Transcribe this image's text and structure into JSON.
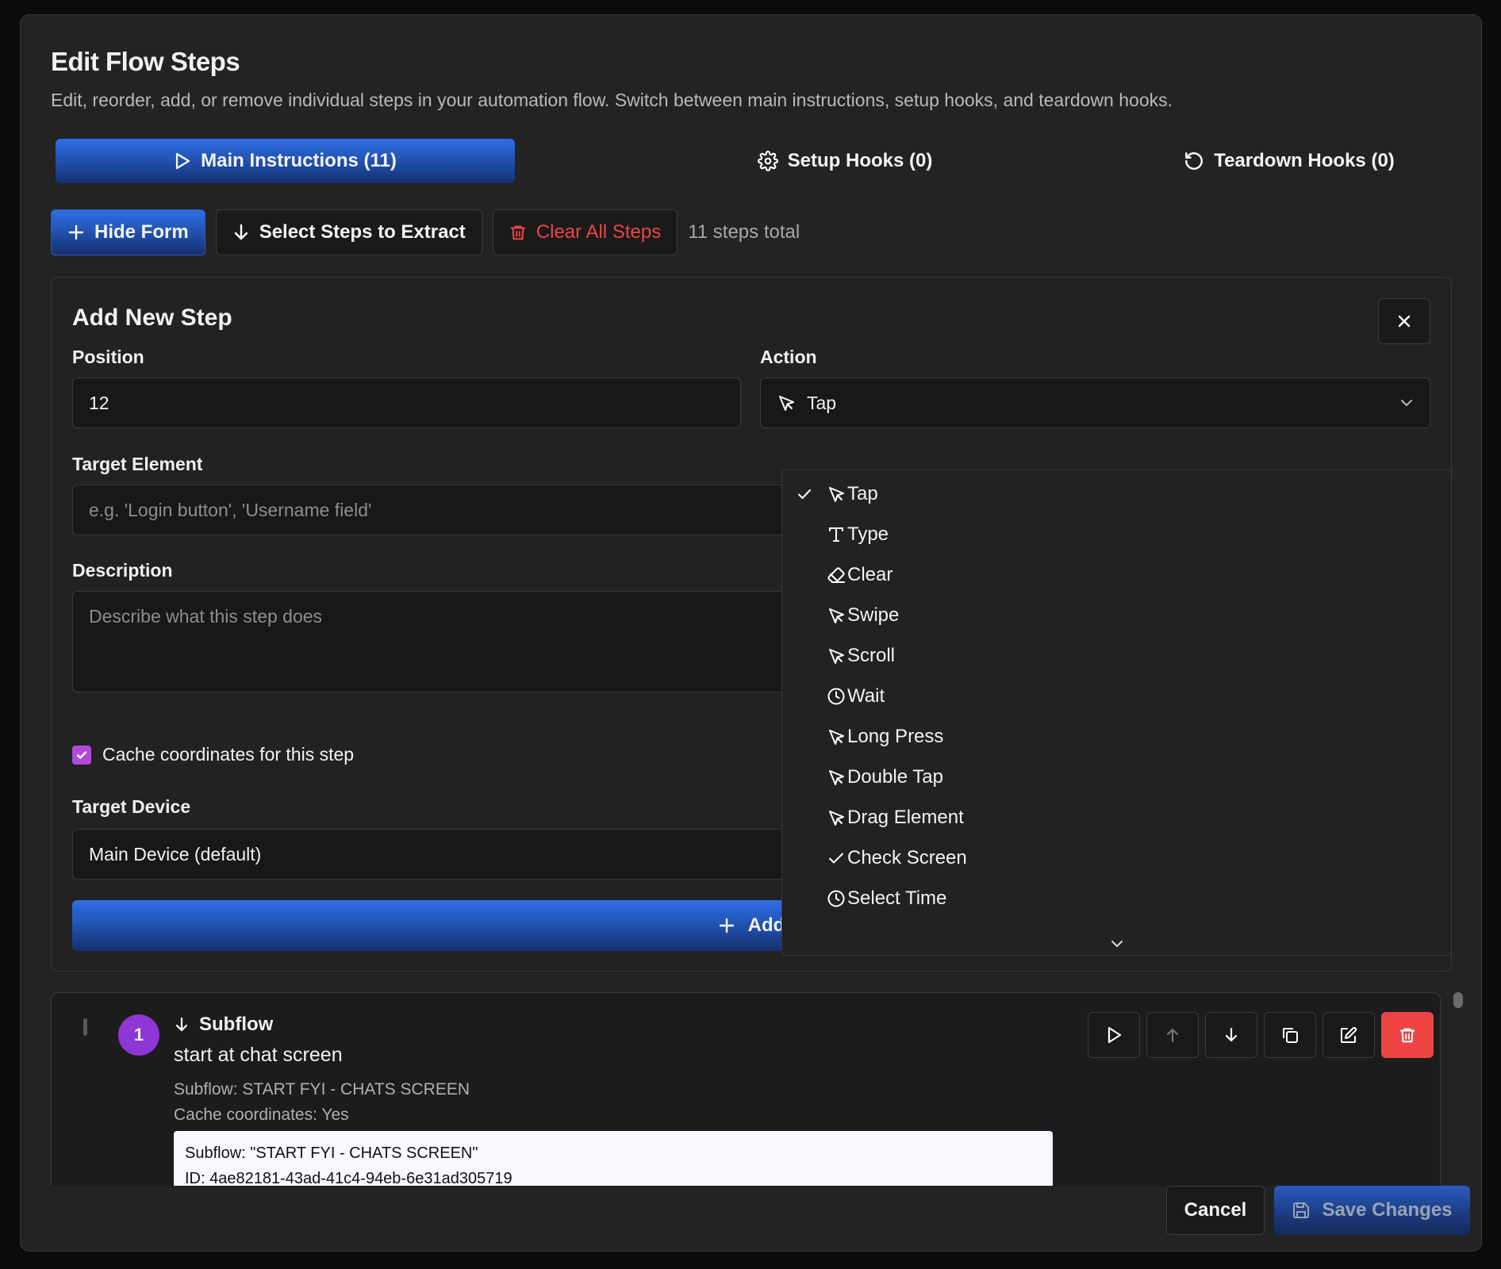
{
  "dialog": {
    "title": "Edit Flow Steps",
    "subtitle": "Edit, reorder, add, or remove individual steps in your automation flow. Switch between main instructions, setup hooks, and teardown hooks."
  },
  "tabs": [
    {
      "label": "Main Instructions (11)",
      "icon": "play-icon",
      "active": true
    },
    {
      "label": "Setup Hooks (0)",
      "icon": "gear-icon",
      "active": false
    },
    {
      "label": "Teardown Hooks (0)",
      "icon": "rotate-ccw-icon",
      "active": false
    }
  ],
  "toolbar": {
    "hide_form_label": "Hide Form",
    "select_steps_label": "Select Steps to Extract",
    "clear_all_label": "Clear All Steps",
    "steps_total": "11 steps total"
  },
  "add_step_form": {
    "title": "Add New Step",
    "position_label": "Position",
    "position_value": "12",
    "action_label": "Action",
    "action_value": "Tap",
    "target_element_label": "Target Element",
    "target_element_placeholder": "e.g. 'Login button', 'Username field'",
    "description_label": "Description",
    "description_placeholder": "Describe what this step does",
    "cache_label": "Cache coordinates for this step",
    "cache_checked": true,
    "target_device_label": "Target Device",
    "target_device_value": "Main Device (default)",
    "add_button_label": "Add"
  },
  "action_options": [
    {
      "label": "Tap",
      "icon": "pointer-icon",
      "selected": true
    },
    {
      "label": "Type",
      "icon": "type-icon",
      "selected": false
    },
    {
      "label": "Clear",
      "icon": "eraser-icon",
      "selected": false
    },
    {
      "label": "Swipe",
      "icon": "pointer-icon",
      "selected": false
    },
    {
      "label": "Scroll",
      "icon": "pointer-icon",
      "selected": false
    },
    {
      "label": "Wait",
      "icon": "clock-icon",
      "selected": false
    },
    {
      "label": "Long Press",
      "icon": "pointer-icon",
      "selected": false
    },
    {
      "label": "Double Tap",
      "icon": "pointer-icon",
      "selected": false
    },
    {
      "label": "Drag Element",
      "icon": "pointer-icon",
      "selected": false
    },
    {
      "label": "Check Screen",
      "icon": "check-icon",
      "selected": false
    },
    {
      "label": "Select Time",
      "icon": "clock-icon",
      "selected": false
    }
  ],
  "steps": [
    {
      "number": "1",
      "type": "Subflow",
      "description": "start at chat screen",
      "meta_subflow": "Subflow: START FYI - CHATS SCREEN",
      "meta_cache": "Cache coordinates: Yes",
      "box_line1": "Subflow: \"START FYI - CHATS SCREEN\"",
      "box_line2": "ID: 4ae82181-43ad-41c4-94eb-6e31ad305719"
    }
  ],
  "footer": {
    "cancel_label": "Cancel",
    "save_label": "Save Changes"
  },
  "colors": {
    "accent_blue": "#2f6fe6",
    "danger_red": "#ef4444",
    "step_badge_purple": "#8f36d6",
    "checkbox_purple": "#b04ad9"
  }
}
